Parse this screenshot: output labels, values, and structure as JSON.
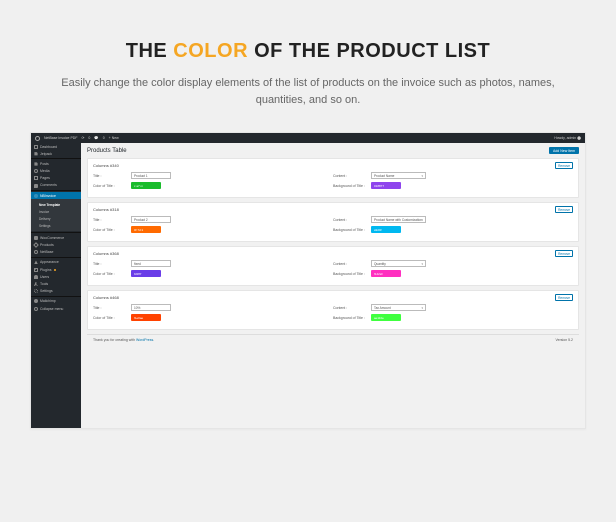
{
  "hero": {
    "pre": "THE",
    "accent": "COLOR",
    "post": "OF THE PRODUCT LIST",
    "sub": "Easily change the color display elements of the list of products on the invoice such as photos, names, quantities, and so on."
  },
  "topbar": {
    "site": "NetBase Invoice PDF",
    "updates": "0",
    "comments": "0",
    "new": "+ New",
    "greeting": "Howdy, admin"
  },
  "sidebar": {
    "items": [
      {
        "label": "Dashboard",
        "icon": "dash"
      },
      {
        "label": "Jetpack",
        "icon": "posts"
      },
      {
        "label": "",
        "sep": true
      },
      {
        "label": "Posts",
        "icon": "posts"
      },
      {
        "label": "Media",
        "icon": "media"
      },
      {
        "label": "Pages",
        "icon": "pages"
      },
      {
        "label": "Comments",
        "icon": "comments"
      },
      {
        "label": "",
        "sep": true
      },
      {
        "label": "NBInvoice",
        "icon": "wb",
        "active": true,
        "subs": [
          {
            "label": "New Template",
            "current": true
          },
          {
            "label": "Invoice"
          },
          {
            "label": "Delivery"
          },
          {
            "label": "Settings"
          }
        ]
      },
      {
        "label": "",
        "sep": true
      },
      {
        "label": "WooCommerce",
        "icon": "woo"
      },
      {
        "label": "Products",
        "icon": "products"
      },
      {
        "label": "NetBase",
        "icon": "globe"
      },
      {
        "label": "",
        "sep": true
      },
      {
        "label": "Appearance",
        "icon": "appearance"
      },
      {
        "label": "Plugins",
        "icon": "plugins",
        "badge": true
      },
      {
        "label": "Users",
        "icon": "users"
      },
      {
        "label": "Tools",
        "icon": "tools"
      },
      {
        "label": "Settings",
        "icon": "settings"
      },
      {
        "label": "",
        "sep": true
      },
      {
        "label": "Mailchimp",
        "icon": "mailchimp"
      },
      {
        "label": "Collapse menu",
        "icon": "collapse"
      }
    ]
  },
  "main": {
    "title": "Products Table",
    "addNew": "Add New Item",
    "labels": {
      "title": "Title :",
      "colorOfTitle": "Color of Title :",
      "content": "Content :",
      "bgOfTitle": "Background of Title :",
      "remove": "Remove"
    },
    "panels": [
      {
        "head": "Columns #340",
        "title": "Product 1",
        "content": "Product Name",
        "colorTitle": {
          "hex": "#1abc2c",
          "text": "c a7 m"
        },
        "bgTitle": {
          "hex": "#8e44ed",
          "text": "018877"
        }
      },
      {
        "head": "Columns #318",
        "title": "Product 2",
        "content": "Product Name with Customization",
        "colorTitle": {
          "hex": "#ff6a00",
          "text": "0f 7d:1"
        },
        "bgTitle": {
          "hex": "#00b8f0",
          "text": "a929f"
        }
      },
      {
        "head": "Columns #368",
        "title": "fixed",
        "content": "Quantity",
        "colorTitle": {
          "hex": "#6a3de8",
          "text": "bf2ff7"
        },
        "bgTitle": {
          "hex": "#ff2fc0",
          "text": "f1422c"
        }
      },
      {
        "head": "Columns #468",
        "title": "10%",
        "content": "Tax Amount",
        "colorTitle": {
          "hex": "#ff4200",
          "text": "f1e0ae"
        },
        "bgTitle": {
          "hex": "#3fff3f",
          "text": "ae110e"
        }
      }
    ]
  },
  "footer": {
    "thanks": "Thank you for creating with ",
    "link": "WordPress",
    "after": ".",
    "version": "Version 5.2"
  }
}
